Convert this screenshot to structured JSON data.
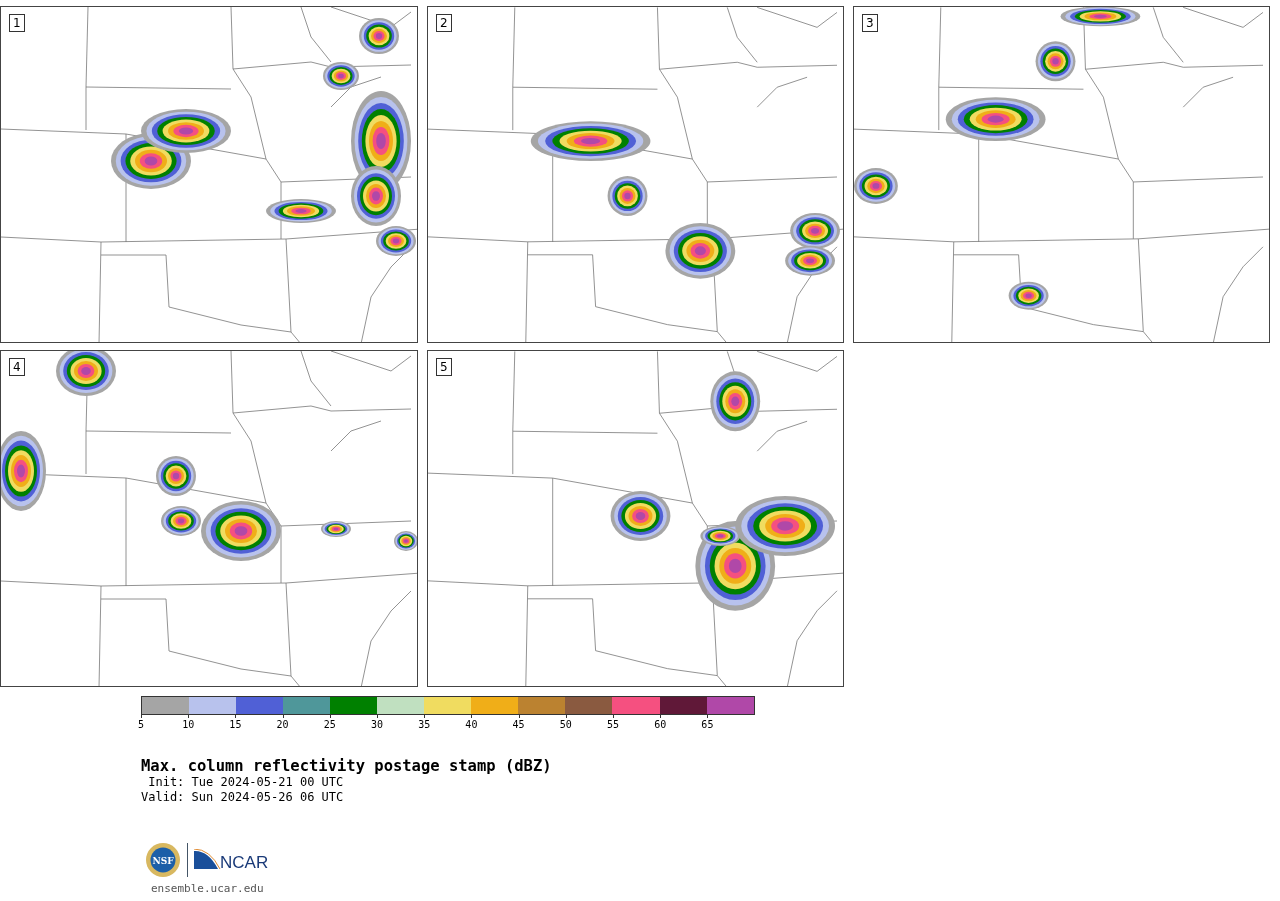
{
  "panels": [
    {
      "label": "1"
    },
    {
      "label": "2"
    },
    {
      "label": "3"
    },
    {
      "label": "4"
    },
    {
      "label": "5"
    }
  ],
  "colorbar": {
    "bins": [
      {
        "color": "#a5a5a5"
      },
      {
        "color": "#b8c2ed"
      },
      {
        "color": "#5060d6"
      },
      {
        "color": "#4f979a"
      },
      {
        "color": "#008000"
      },
      {
        "color": "#c0e0c0"
      },
      {
        "color": "#f0dc60"
      },
      {
        "color": "#f0ae18"
      },
      {
        "color": "#bb8230"
      },
      {
        "color": "#8a5a40"
      },
      {
        "color": "#f55080"
      },
      {
        "color": "#601838"
      },
      {
        "color": "#b048a8"
      }
    ],
    "ticks": [
      "5",
      "10",
      "15",
      "20",
      "25",
      "30",
      "35",
      "40",
      "45",
      "50",
      "55",
      "60",
      "65"
    ]
  },
  "title": "Max. column reflectivity postage stamp (dBZ)",
  "init": " Init: Tue 2024-05-21 00 UTC",
  "valid": "Valid: Sun 2024-05-26 06 UTC",
  "logos": {
    "nsf": "NSF",
    "ncar": "NCAR"
  },
  "website": "ensemble.ucar.edu"
}
